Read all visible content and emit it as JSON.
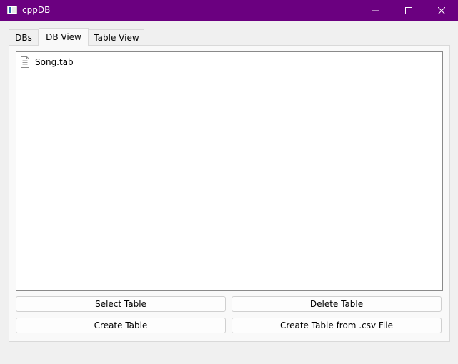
{
  "window": {
    "title": "cppDB"
  },
  "tabs": [
    {
      "label": "DBs",
      "active": false
    },
    {
      "label": "DB View",
      "active": true
    },
    {
      "label": "Table View",
      "active": false
    }
  ],
  "db_view": {
    "tables": [
      {
        "name": "Song.tab",
        "icon": "document-icon"
      }
    ],
    "buttons": {
      "select": "Select Table",
      "delete": "Delete Table",
      "create": "Create Table",
      "create_csv": "Create Table from .csv File"
    }
  },
  "colors": {
    "titlebar": "#6b0080",
    "window_bg": "#f0f0f0",
    "pane_bg": "#f9f9f9"
  }
}
